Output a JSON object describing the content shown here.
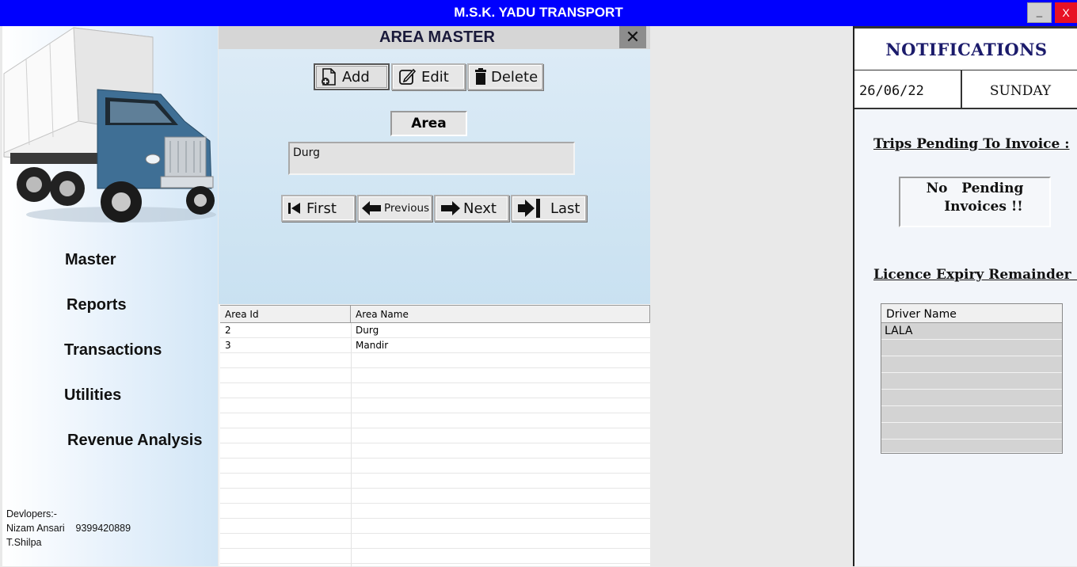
{
  "window": {
    "title": "M.S.K. YADU TRANSPORT",
    "min_label": "_",
    "close_label": "X"
  },
  "sidebar": {
    "menu": [
      {
        "label": "Master"
      },
      {
        "label": "Reports"
      },
      {
        "label": "Transactions"
      },
      {
        "label": "Utilities"
      },
      {
        "label": "Revenue Analysis"
      }
    ],
    "developers": {
      "heading": "Devlopers:-",
      "line1": "Nizam Ansari    9399420889",
      "line2": "T.Shilpa"
    }
  },
  "area_master": {
    "title": "AREA MASTER",
    "close_label": "✕",
    "buttons": {
      "add": "Add",
      "edit": "Edit",
      "delete": "Delete"
    },
    "field_label": "Area",
    "field_value": "Durg",
    "nav": {
      "first": "First",
      "previous": "Previous",
      "next": "Next",
      "last": "Last"
    },
    "grid": {
      "columns": [
        "Area Id",
        "Area Name"
      ],
      "rows": [
        [
          "2",
          "Durg"
        ],
        [
          "3",
          "Mandir"
        ]
      ]
    }
  },
  "notifications": {
    "title": "NOTIFICATIONS",
    "date": "26/06/22",
    "day": "SUNDAY",
    "trips_title": "Trips Pending To Invoice :",
    "pending_line1": "No   Pending",
    "pending_line2": "Invoices  !!",
    "licence_title": "Licence Expiry Remainder :",
    "driver_grid": {
      "column": "Driver Name",
      "rows": [
        "LALA"
      ]
    }
  },
  "colors": {
    "titlebar": "#0000fe",
    "close": "#e81123",
    "notif_title": "#1b1b6b"
  }
}
